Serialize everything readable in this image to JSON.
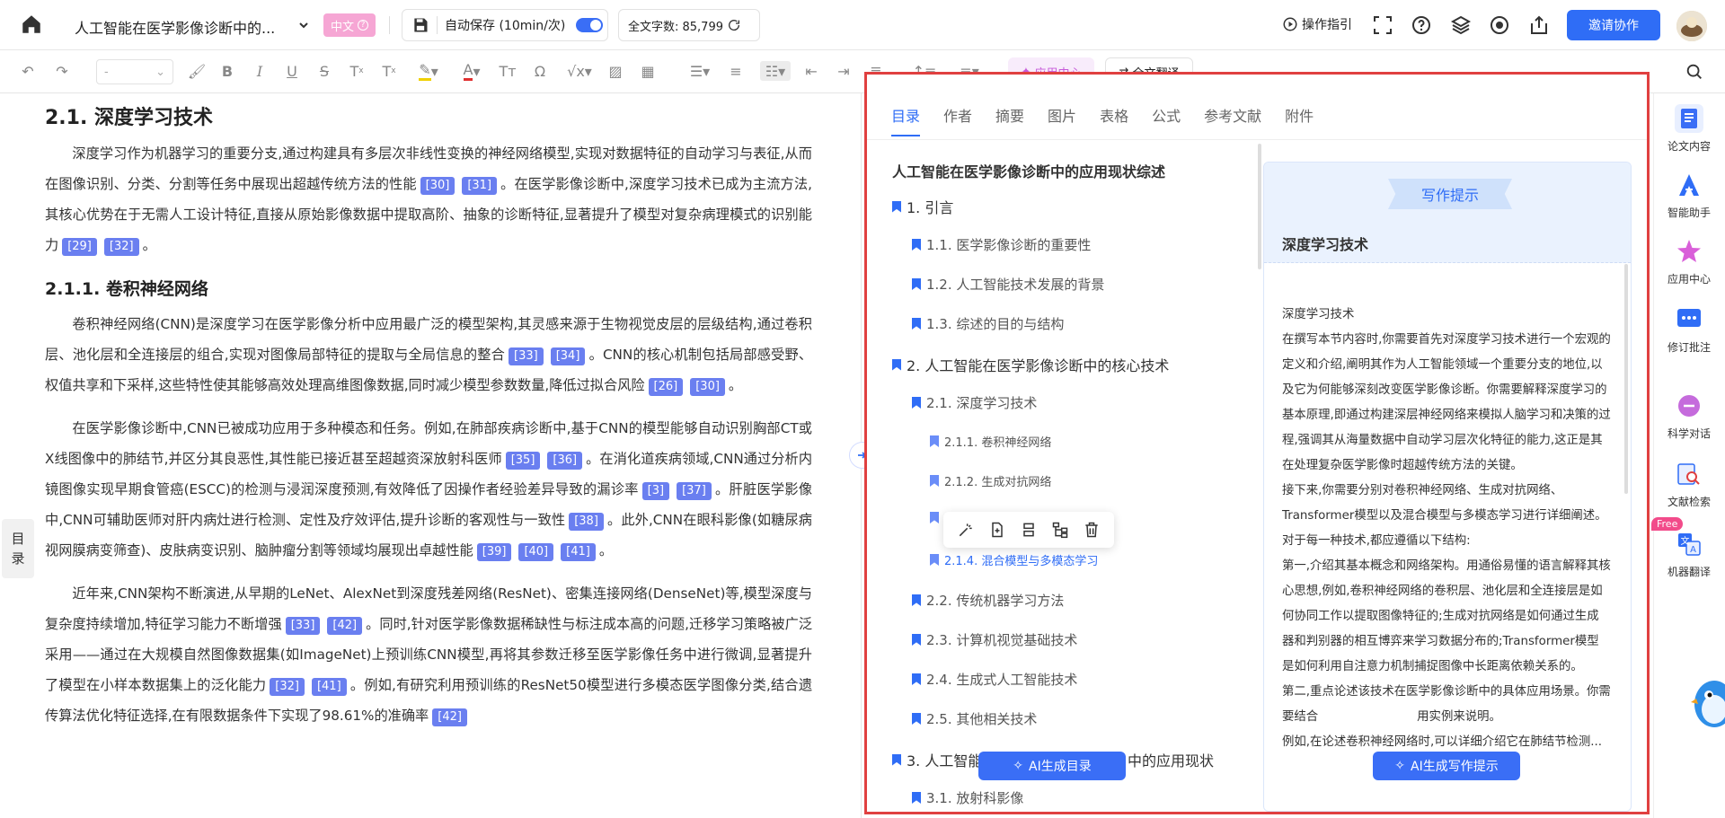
{
  "header": {
    "doc_title": "人工智能在医学影像诊断中的...",
    "language_badge": "中文",
    "autosave_label": "自动保存 (10min/次)",
    "word_count_label": "全文字数: 85,799",
    "guide_label": "操作指引",
    "invite_label": "邀请协作"
  },
  "toolbar": {
    "font_select_value": "-",
    "app_center_label": "应用中心",
    "full_translate_label": "全文翻译"
  },
  "editor": {
    "toc_tab": [
      "目",
      "录"
    ],
    "h2": "2.1.   深度学习技术",
    "p1": [
      "深度学习作为机器学习的重要分支,通过构建具有多层次非线性变换的神经网络模型,实现对数据特征的自动学习与表征,从而在图像识别、分类、分割等任务中展现出超越传统方法的性能",
      "。在医学影像诊断中,深度学习技术已成为主流方法,其核心优势在于无需人工设计特征,直接从原始影像数据中提取高阶、抽象的诊断特征,显著提升了模型对复杂病理模式的识别能力",
      "。"
    ],
    "p1_refs": [
      [
        "[30]",
        "[31]"
      ],
      [
        "[29]",
        "[32]"
      ]
    ],
    "h3": "2.1.1.   卷积神经网络",
    "p2": [
      "卷积神经网络(CNN)是深度学习在医学影像分析中应用最广泛的模型架构,其灵感来源于生物视觉皮层的层级结构,通过卷积层、池化层和全连接层的组合,实现对图像局部特征的提取与全局信息的整合",
      "。CNN的核心机制包括局部感受野、权值共享和下采样,这些特性使其能够高效处理高维图像数据,同时减少模型参数数量,降低过拟合风险",
      "。"
    ],
    "p2_refs": [
      [
        "[33]",
        "[34]"
      ],
      [
        "[26]",
        "[30]"
      ]
    ],
    "p3": [
      "在医学影像诊断中,CNN已被成功应用于多种模态和任务。例如,在肺部疾病诊断中,基于CNN的模型能够自动识别胸部CT或X线图像中的肺结节,并区分其良恶性,其性能已接近甚至超越资深放射科医师",
      "。在消化道疾病领域,CNN通过分析内镜图像实现早期食管癌(ESCC)的检测与浸润深度预测,有效降低了因操作者经验差异导致的漏诊率",
      "。肝脏医学影像中,CNN可辅助医师对肝内病灶进行检测、定性及疗效评估,提升诊断的客观性与一致性",
      "。此外,CNN在眼科影像(如糖尿病视网膜病变筛查)、皮肤病变识别、脑肿瘤分割等领域均展现出卓越性能",
      "。"
    ],
    "p3_refs": [
      [
        "[35]",
        "[36]"
      ],
      [
        "[3]",
        "[37]"
      ],
      [
        "[38]"
      ],
      [
        "[39]",
        "[40]",
        "[41]"
      ]
    ],
    "p4": [
      "近年来,CNN架构不断演进,从早期的LeNet、AlexNet到深度残差网络(ResNet)、密集连接网络(DenseNet)等,模型深度与复杂度持续增加,特征学习能力不断增强",
      "。同时,针对医学影像数据稀缺性与标注成本高的问题,迁移学习策略被广泛采用——通过在大规模自然图像数据集(如ImageNet)上预训练CNN模型,再将其参数迁移至医学影像任务中进行微调,显著提升了模型在小样本数据集上的泛化能力",
      "。例如,有研究利用预训练的ResNet50模型进行多模态医学图像分类,结合遗传算法优化特征选择,在有限数据条件下实现了98.61%的准确率",
      ""
    ],
    "p4_refs": [
      [
        "[33]",
        "[42]"
      ],
      [
        "[32]",
        "[41]"
      ],
      [
        "[42]"
      ]
    ]
  },
  "panel": {
    "tabs": [
      "目录",
      "作者",
      "摘要",
      "图片",
      "表格",
      "公式",
      "参考文献",
      "附件"
    ],
    "outline_title": "人工智能在医学影像诊断中的应用现状综述",
    "outline": [
      {
        "label": "1.  引言",
        "level": 1
      },
      {
        "label": "1.1.  医学影像诊断的重要性",
        "level": 2
      },
      {
        "label": "1.2.  人工智能技术发展的背景",
        "level": 2
      },
      {
        "label": "1.3.  综述的目的与结构",
        "level": 2
      },
      {
        "label": "2.  人工智能在医学影像诊断中的核心技术",
        "level": 1
      },
      {
        "label": "2.1.  深度学习技术",
        "level": 2
      },
      {
        "label": "2.1.1.  卷积神经网络",
        "level": 3
      },
      {
        "label": "2.1.2.  生成对抗网络",
        "level": 3
      },
      {
        "label": "",
        "level": 3
      },
      {
        "label": "2.1.4.  混合模型与多模态学习",
        "level": 3
      },
      {
        "label": "2.2.  传统机器学习方法",
        "level": 2
      },
      {
        "label": "2.3.  计算机视觉基础技术",
        "level": 2
      },
      {
        "label": "2.4.  生成式人工智能技术",
        "level": 2
      },
      {
        "label": "2.5.  其他相关技术",
        "level": 2
      },
      {
        "label": "3.  人工智能",
        "level": 1
      },
      {
        "label": "中的应用现状",
        "level": 1
      },
      {
        "label": "3.1.  放射科影像",
        "level": 2
      }
    ],
    "ai_outline_btn": "AI生成目录",
    "hint_ribbon": "写作提示",
    "hint_title": "深度学习技术",
    "hint_paras": [
      "深度学习技术",
      "在撰写本节内容时,你需要首先对深度学习技术进行一个宏观的定义和介绍,阐明其作为人工智能领域一个重要分支的地位,以及它为何能够深刻改变医学影像诊断。你需要解释深度学习的基本原理,即通过构建深层神经网络来模拟人脑学习和决策的过程,强调其从海量数据中自动学习层次化特征的能力,这正是其在处理复杂医学影像时超越传统方法的关键。",
      "接下来,你需要分别对卷积神经网络、生成对抗网络、Transformer模型以及混合模型与多模态学习进行详细阐述。对于每一种技术,都应遵循以下结构:",
      "第一,介绍其基本概念和网络架构。用通俗易懂的语言解释其核心思想,例如,卷积神经网络的卷积层、池化层和全连接层是如何协同工作以提取图像特征的;生成对抗网络是如何通过生成器和判别器的相互博弈来学习数据分布的;Transformer模型是如何利用自注意力机制捕捉图像中长距离依赖关系的。",
      "第二,重点论述该技术在医学影像诊断中的具体应用场景。你需要结合",
      "用实例来说明。",
      "例如,在论述卷积神经网络时,可以详细介绍它在肺结节检测..."
    ],
    "ai_hint_btn": "AI生成写作提示"
  },
  "rail": {
    "items": [
      "论文内容",
      "智能助手",
      "应用中心",
      "修订批注",
      "科学对话",
      "文献检索",
      "机器翻译"
    ],
    "free_badge": "Free"
  },
  "colors": {
    "accent": "#2f6df6",
    "ref_tag": "#6a7ff0",
    "panel_border": "#e04040"
  }
}
